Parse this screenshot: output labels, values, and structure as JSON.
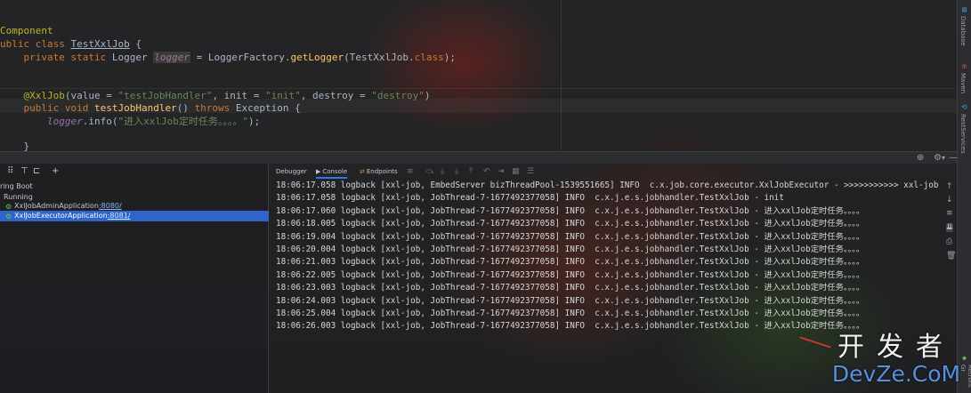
{
  "editor": {
    "lines": [
      {
        "segments": [
          {
            "t": "Component",
            "c": "ann"
          }
        ]
      },
      {
        "segments": [
          {
            "t": "ublic class ",
            "c": "kw"
          },
          {
            "t": "TestXxlJob",
            "c": "cls und"
          },
          {
            "t": " {",
            "c": "cls"
          }
        ]
      },
      {
        "segments": [
          {
            "t": "    private static ",
            "c": "kw"
          },
          {
            "t": "Logger ",
            "c": "cls"
          },
          {
            "t": "logger",
            "c": "hl"
          },
          {
            "t": " = LoggerFactory.",
            "c": "cls"
          },
          {
            "t": "getLogger",
            "c": "fn"
          },
          {
            "t": "(TestXxlJob.",
            "c": "cls"
          },
          {
            "t": "class",
            "c": "kw"
          },
          {
            "t": ");",
            "c": "cls"
          }
        ]
      },
      {
        "segments": [
          {
            "t": "",
            "c": "cls"
          }
        ]
      },
      {
        "segments": [
          {
            "t": "",
            "c": "cls"
          }
        ]
      },
      {
        "segments": [
          {
            "t": "    @XxlJob",
            "c": "ann"
          },
          {
            "t": "(value = ",
            "c": "cls"
          },
          {
            "t": "\"testJobHandler\"",
            "c": "str"
          },
          {
            "t": ", init = ",
            "c": "cls"
          },
          {
            "t": "\"init\"",
            "c": "str"
          },
          {
            "t": ", destroy = ",
            "c": "cls"
          },
          {
            "t": "\"destroy\"",
            "c": "str"
          },
          {
            "t": ")",
            "c": "cls"
          }
        ]
      },
      {
        "segments": [
          {
            "t": "    public void ",
            "c": "kw"
          },
          {
            "t": "testJobHandler",
            "c": "fn"
          },
          {
            "t": "() ",
            "c": "cls"
          },
          {
            "t": "throws ",
            "c": "kw"
          },
          {
            "t": "Exception {",
            "c": "cls"
          }
        ]
      },
      {
        "segments": [
          {
            "t": "        ",
            "c": "cls"
          },
          {
            "t": "logger",
            "c": "field"
          },
          {
            "t": ".info(",
            "c": "cls"
          },
          {
            "t": "\"进入xxlJob定时任务。。。。\"",
            "c": "str"
          },
          {
            "t": ");",
            "c": "cls"
          }
        ]
      },
      {
        "segments": [
          {
            "t": "",
            "c": "cls"
          }
        ]
      },
      {
        "segments": [
          {
            "t": "    }",
            "c": "cls"
          }
        ]
      }
    ]
  },
  "right_strip": {
    "tabs": [
      "Database",
      "Maven",
      "RestServices",
      "Retrofit Gr"
    ]
  },
  "services": {
    "items": [
      {
        "label": "ring Boot",
        "indent": 0
      },
      {
        "label": "Running",
        "indent": 1
      },
      {
        "label": "XxlJobAdminApplication",
        "port": ":8080/",
        "indent": 2,
        "selected": false
      },
      {
        "label": "XxlJobExecutorApplication",
        "port": ":8081/",
        "indent": 2,
        "selected": true
      }
    ]
  },
  "console_tabs": {
    "debugger": "Debugger",
    "console": "Console",
    "endpoints": "Endpoints"
  },
  "log_lines": [
    "18:06:17.058 logback [xxl-job, EmbedServer bizThreadPool-1539551665] INFO  c.x.job.core.executor.XxlJobExecutor - >>>>>>>>>>> xxl-job regis",
    "18:06:17.058 logback [xxl-job, JobThread-7-1677492377058] INFO  c.x.j.e.s.jobhandler.TestXxlJob - init",
    "18:06:17.060 logback [xxl-job, JobThread-7-1677492377058] INFO  c.x.j.e.s.jobhandler.TestXxlJob - 进入xxlJob定时任务。。。。",
    "18:06:18.005 logback [xxl-job, JobThread-7-1677492377058] INFO  c.x.j.e.s.jobhandler.TestXxlJob - 进入xxlJob定时任务。。。。",
    "18:06:19.004 logback [xxl-job, JobThread-7-1677492377058] INFO  c.x.j.e.s.jobhandler.TestXxlJob - 进入xxlJob定时任务。。。。",
    "18:06:20.004 logback [xxl-job, JobThread-7-1677492377058] INFO  c.x.j.e.s.jobhandler.TestXxlJob - 进入xxlJob定时任务。。。。",
    "18:06:21.003 logback [xxl-job, JobThread-7-1677492377058] INFO  c.x.j.e.s.jobhandler.TestXxlJob - 进入xxlJob定时任务。。。。",
    "18:06:22.005 logback [xxl-job, JobThread-7-1677492377058] INFO  c.x.j.e.s.jobhandler.TestXxlJob - 进入xxlJob定时任务。。。。",
    "18:06:23.003 logback [xxl-job, JobThread-7-1677492377058] INFO  c.x.j.e.s.jobhandler.TestXxlJob - 进入xxlJob定时任务。。。。",
    "18:06:24.003 logback [xxl-job, JobThread-7-1677492377058] INFO  c.x.j.e.s.jobhandler.TestXxlJob - 进入xxlJob定时任务。。。。",
    "18:06:25.004 logback [xxl-job, JobThread-7-1677492377058] INFO  c.x.j.e.s.jobhandler.TestXxlJob - 进入xxlJob定时任务。。。。",
    "18:06:26.003 logback [xxl-job, JobThread-7-1677492377058] INFO  c.x.j.e.s.jobhandler.TestXxlJob - 进入xxlJob定时任务。。。。"
  ],
  "watermark": {
    "top": "开发者",
    "bottom": "DevZe.CoM"
  },
  "colors": {
    "selection": "#2f65ca",
    "accent": "#3574f0",
    "running": "#6cc04a"
  }
}
